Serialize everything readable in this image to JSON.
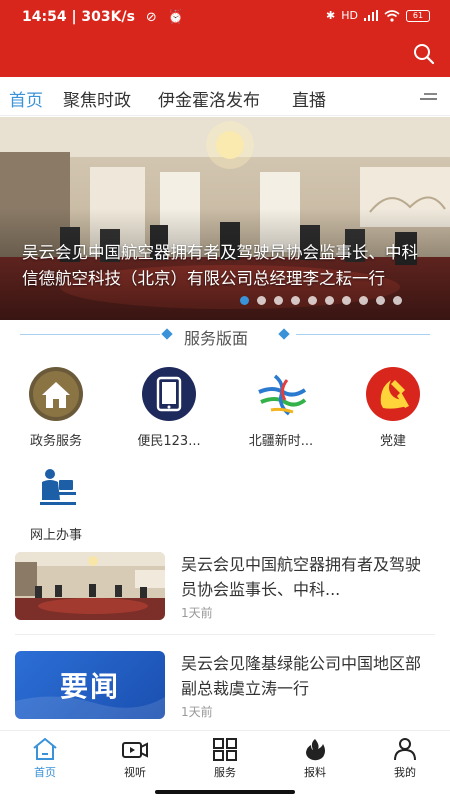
{
  "status_bar": {
    "time_speed": "14:54 | 303K/s",
    "signal_text": "HD",
    "battery": "61"
  },
  "tabs": [
    {
      "label": "首页",
      "active": true
    },
    {
      "label": "聚焦时政",
      "active": false
    },
    {
      "label": "伊金霍洛发布",
      "active": false
    },
    {
      "label": "直播",
      "active": false
    }
  ],
  "banner": {
    "title": "吴云会见中国航空器拥有者及驾驶员协会监事长、中科信德航空科技（北京）有限公司总经理李之耘一行",
    "dot_count": 10,
    "active_dot": 0
  },
  "section": {
    "title": "服务版面"
  },
  "services": [
    {
      "label": "政务服务",
      "icon": "house-icon"
    },
    {
      "label": "便民123...",
      "icon": "tablet-icon"
    },
    {
      "label": "北疆新时...",
      "icon": "ribbon-logo-icon"
    },
    {
      "label": "党建",
      "icon": "party-emblem-icon"
    },
    {
      "label": "网上办事",
      "icon": "online-service-icon"
    }
  ],
  "news": [
    {
      "title": "吴云会见中国航空器拥有者及驾驶员协会监事长、中科...",
      "time": "1天前",
      "thumb": "meeting-photo"
    },
    {
      "title": "吴云会见隆基绿能公司中国地区部副总裁虞立涛一行",
      "time": "1天前",
      "thumb_text": "要闻"
    }
  ],
  "bottom_nav": [
    {
      "label": "首页",
      "icon": "home-icon",
      "active": true
    },
    {
      "label": "视听",
      "icon": "video-camera-icon",
      "active": false
    },
    {
      "label": "服务",
      "icon": "grid-icon",
      "active": false
    },
    {
      "label": "报料",
      "icon": "flame-icon",
      "active": false
    },
    {
      "label": "我的",
      "icon": "user-icon",
      "active": false
    }
  ],
  "colors": {
    "header_red": "#d9261c",
    "accent_blue": "#3a92d8"
  }
}
